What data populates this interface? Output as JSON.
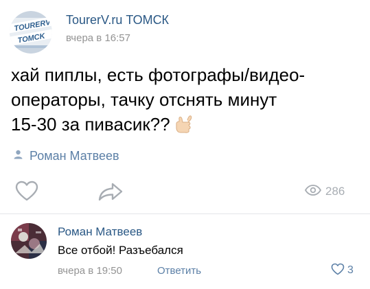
{
  "post": {
    "group": {
      "avatar_icon": "tourerv-tomsk-logo",
      "avatar_label": "TOURERV",
      "avatar_city": "TOMCK",
      "name": "TourerV.ru ТОМСК",
      "time": "вчера в 16:57"
    },
    "text_lines": [
      "хай пиплы, есть фотографы/видео-",
      "операторы, тачку отснять минут",
      "15-30 за пивасик??"
    ],
    "emoji": "call-me-hand-emoji",
    "signer": {
      "icon": "person-icon",
      "name": "Роман Матвеев"
    },
    "actions": {
      "like_icon": "heart-icon",
      "share_icon": "share-arrow-icon",
      "views_icon": "eye-icon",
      "views_count": "286"
    }
  },
  "comment": {
    "avatar_icon": "user-avatar",
    "author": "Роман Матвеев",
    "text": "Все отбой! Разъебался",
    "time": "вчера в 19:50",
    "reply_label": "Ответить",
    "likes_icon": "heart-outline-icon",
    "likes_count": "3"
  },
  "colors": {
    "link": "#2a5885",
    "muted": "#939393",
    "accent": "#5b7fa6",
    "icon_gray": "#a8adb3"
  }
}
